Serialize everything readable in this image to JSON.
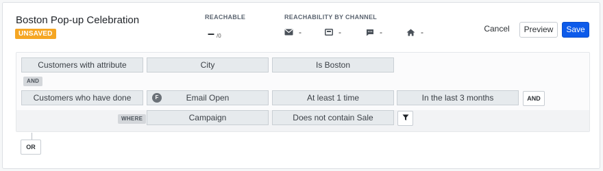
{
  "header": {
    "title": "Boston Pop-up Celebration",
    "status_badge": "UNSAVED",
    "reachable": {
      "label": "REACHABLE",
      "value": "–",
      "denominator": "/0"
    },
    "reachability_by_channel": {
      "label": "REACHABILITY BY CHANNEL",
      "channels": [
        {
          "icon": "email-icon",
          "value": "-"
        },
        {
          "icon": "in-app-message-icon",
          "value": "-"
        },
        {
          "icon": "sms-icon",
          "value": "-"
        },
        {
          "icon": "home-icon",
          "value": "-"
        }
      ]
    },
    "actions": {
      "cancel": "Cancel",
      "preview": "Preview",
      "save": "Save"
    }
  },
  "builder": {
    "row1": {
      "type": "Customers with attribute",
      "attribute": "City",
      "condition": "Is Boston"
    },
    "and_tag": "AND",
    "row2": {
      "type": "Customers who have done",
      "event_badge": "F",
      "event": "Email Open",
      "frequency": "At least 1 time",
      "timeframe": "In the last 3 months",
      "and_button": "AND"
    },
    "where_row": {
      "tag": "WHERE",
      "property": "Campaign",
      "condition": "Does not contain Sale"
    },
    "or_button": "OR"
  },
  "colors": {
    "accent": "#0d5bea",
    "unsaved": "#f5a623"
  }
}
